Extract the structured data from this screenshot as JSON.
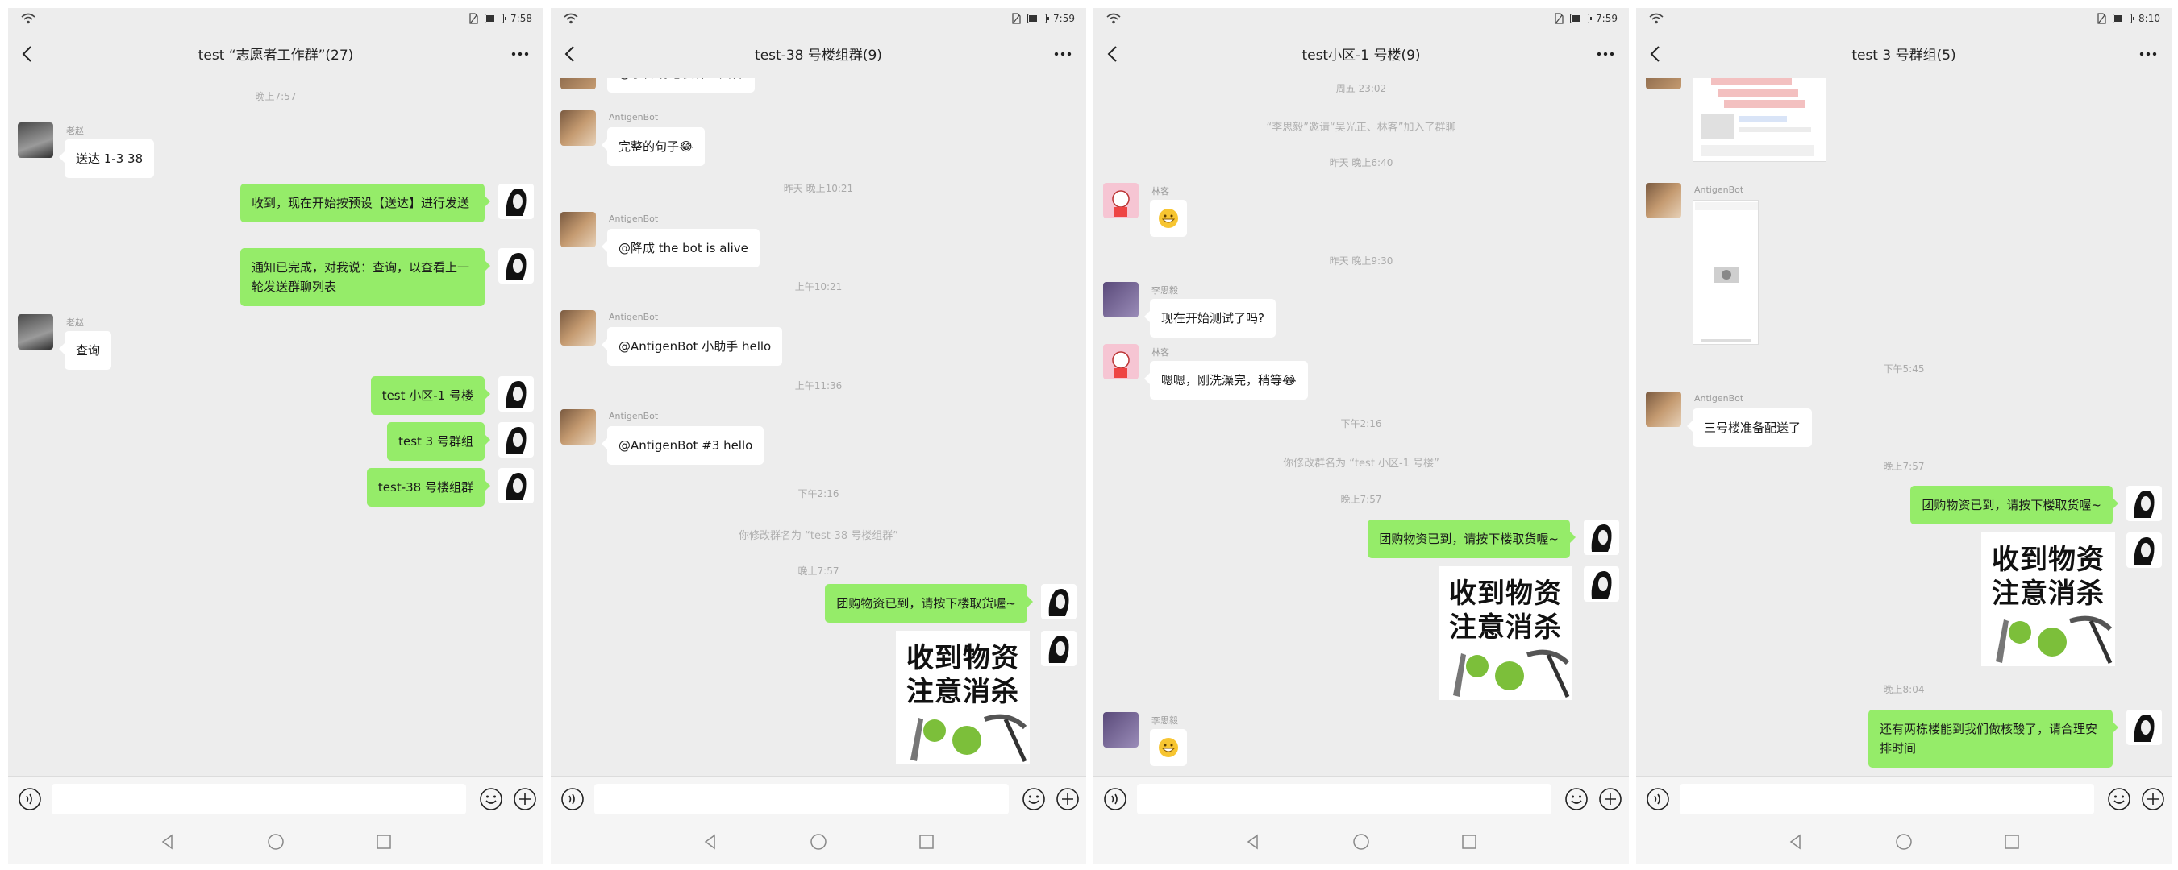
{
  "colors": {
    "chat_bg": "#ededed",
    "sent_bubble": "#95ec69",
    "received_bubble": "#ffffff",
    "timestamp": "#aaaaaa"
  },
  "icons": [
    "wifi-icon",
    "sim-icon",
    "battery-icon",
    "back-icon",
    "more-icon",
    "voice-icon",
    "emoji-icon",
    "plus-icon",
    "nav-back-icon",
    "nav-home-icon",
    "nav-recents-icon"
  ],
  "sticker": {
    "line1": "收到物资",
    "line2": "注意消杀"
  },
  "screens": [
    {
      "status": {
        "time": "7:58",
        "battery_level": 0.5
      },
      "title": "test “志愿者工作群”(27)",
      "messages": {
        "ts1": "晚上7:57",
        "n1": "老赵",
        "m1": "送达 1-3 38",
        "m2": "收到，现在开始按预设【送达】进行发送",
        "m3": "通知已完成，对我说：查询，以查看上一轮发送群聊列表",
        "n2": "老赵",
        "m4": "查询",
        "m5": "test 小区-1 号楼",
        "m6": "test 3 号群组",
        "m7": "test-38 号楼组群"
      }
    },
    {
      "status": {
        "time": "7:59",
        "battery_level": 0.5
      },
      "title": "test-38 号楼组群(9)",
      "messages": {
        "m0": "@丁香 你想要什么回答",
        "n1": "AntigenBot",
        "m1": "完整的句子😂",
        "ts1": "昨天 晚上10:21",
        "n2": "AntigenBot",
        "m2": "@降成 the bot is alive",
        "ts2": "上午10:21",
        "n3": "AntigenBot",
        "m3": "@AntigenBot 小助手 hello",
        "ts3": "上午11:36",
        "n4": "AntigenBot",
        "m4": "@AntigenBot #3 hello",
        "ts4": "下午2:16",
        "sys1": "你修改群名为 “test-38 号楼组群”",
        "ts5": "晚上7:57",
        "m5": "团购物资已到，请按下楼取货喔~"
      }
    },
    {
      "status": {
        "time": "7:59",
        "battery_level": 0.5
      },
      "title": "test小区-1 号楼(9)",
      "messages": {
        "ts0": "周五 23:02",
        "sys0": "“李思毅”邀请“吴光正、林客”加入了群聊",
        "ts1": "昨天 晚上6:40",
        "n1": "林客",
        "ts2": "昨天 晚上9:30",
        "n2": "李思毅",
        "m2": "现在开始测试了吗?",
        "n3": "林客",
        "m3": "嗯嗯，刚洗澡完，稍等😂",
        "ts3": "下午2:16",
        "sys1": "你修改群名为 “test 小区-1 号楼”",
        "ts4": "晚上7:57",
        "m4": "团购物资已到，请按下楼取货喔~",
        "n4": "李思毅"
      }
    },
    {
      "status": {
        "time": "8:10",
        "battery_level": 0.5
      },
      "title": "test 3 号群组(5)",
      "messages": {
        "n1": "AntigenBot",
        "ts1": "下午5:45",
        "n2": "AntigenBot",
        "m2": "三号楼准备配送了",
        "ts2": "晚上7:57",
        "m3": "团购物资已到，请按下楼取货喔~",
        "ts3": "晚上8:04",
        "m4": "还有两栋楼能到我们做核酸了，请合理安排时间"
      }
    }
  ]
}
